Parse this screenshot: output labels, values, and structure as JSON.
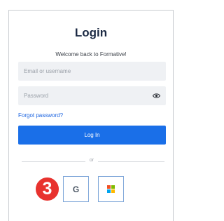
{
  "login": {
    "title": "Login",
    "subtitle": "Welcome back to Formative!",
    "email_placeholder": "Email or username",
    "email_value": "",
    "password_placeholder": "Password",
    "password_value": "",
    "forgot_label": "Forgot password?",
    "login_button_label": "Log In",
    "divider_text": "or"
  },
  "sso": {
    "google_glyph": "G",
    "google_icon": "google-icon",
    "microsoft_icon": "microsoft-icon",
    "microsoft_colors": [
      "#f25022",
      "#7fba00",
      "#00a4ef",
      "#ffb900"
    ]
  },
  "annotation": {
    "step_number": "3",
    "color": "#e8322e"
  },
  "colors": {
    "primary": "#1a6fe8",
    "link": "#1a63e0",
    "title": "#1c2a44"
  }
}
